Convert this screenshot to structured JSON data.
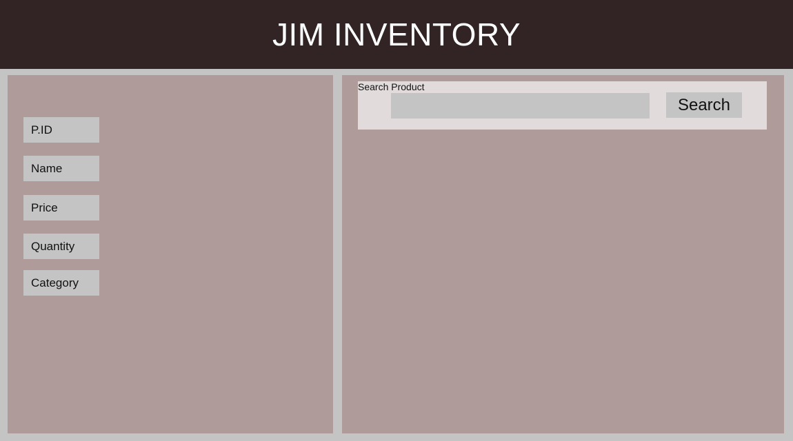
{
  "header": {
    "title": "JIM INVENTORY"
  },
  "product_form": {
    "fields": [
      {
        "label": "P.ID"
      },
      {
        "label": "Name"
      },
      {
        "label": "Price"
      },
      {
        "label": "Quantity"
      },
      {
        "label": "Category"
      }
    ]
  },
  "search": {
    "caption": "Search Product",
    "input_value": "",
    "input_placeholder": "",
    "button_label": "Search"
  },
  "colors": {
    "header_background": "#322424",
    "panel_background": "#af9b9a",
    "page_background": "#c4c4c4",
    "search_box_background": "#e2dbdb"
  }
}
